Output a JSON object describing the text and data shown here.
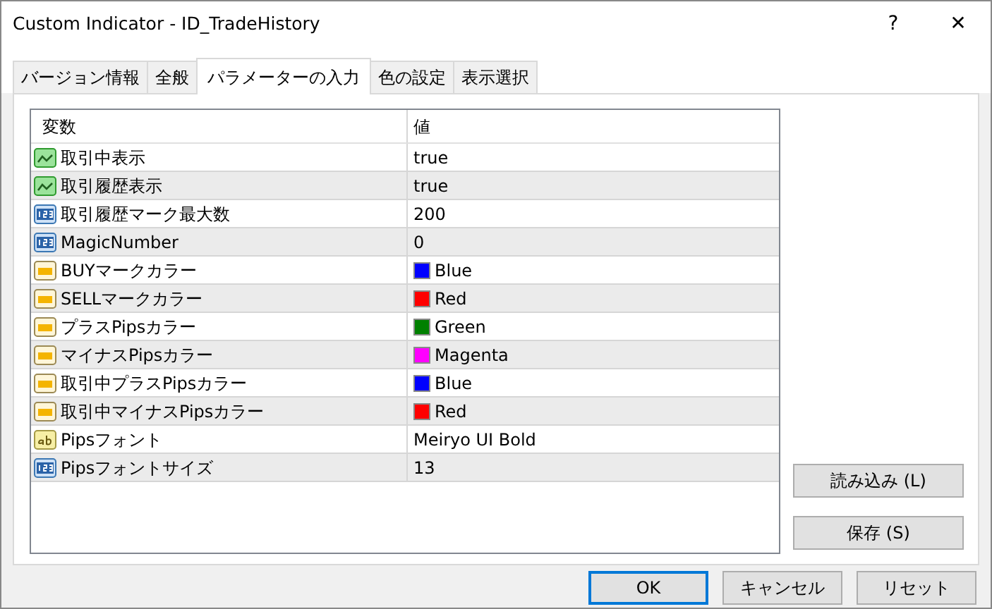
{
  "window": {
    "title": "Custom Indicator - ID_TradeHistory",
    "help": "?",
    "close": "✕"
  },
  "tabs": [
    {
      "label": "バージョン情報",
      "selected": false
    },
    {
      "label": "全般",
      "selected": false
    },
    {
      "label": "パラメーターの入力",
      "selected": true
    },
    {
      "label": "色の設定",
      "selected": false
    },
    {
      "label": "表示選択",
      "selected": false
    }
  ],
  "table": {
    "columns": [
      "変数",
      "値"
    ],
    "rows": [
      {
        "kind": "bool",
        "name": "取引中表示",
        "value": "true"
      },
      {
        "kind": "bool",
        "name": "取引履歴表示",
        "value": "true"
      },
      {
        "kind": "int",
        "name": "取引履歴マーク最大数",
        "value": "200"
      },
      {
        "kind": "int",
        "name": "MagicNumber",
        "value": "0"
      },
      {
        "kind": "color",
        "name": "BUYマークカラー",
        "value": "Blue",
        "color": "#0000ff"
      },
      {
        "kind": "color",
        "name": "SELLマークカラー",
        "value": "Red",
        "color": "#ff0000"
      },
      {
        "kind": "color",
        "name": "プラスPipsカラー",
        "value": "Green",
        "color": "#008000"
      },
      {
        "kind": "color",
        "name": "マイナスPipsカラー",
        "value": "Magenta",
        "color": "#ff00ff"
      },
      {
        "kind": "color",
        "name": "取引中プラスPipsカラー",
        "value": "Blue",
        "color": "#0000ff"
      },
      {
        "kind": "color",
        "name": "取引中マイナスPipsカラー",
        "value": "Red",
        "color": "#ff0000"
      },
      {
        "kind": "string",
        "name": "Pipsフォント",
        "value": "Meiryo UI Bold"
      },
      {
        "kind": "int",
        "name": "Pipsフォントサイズ",
        "value": "13"
      }
    ]
  },
  "side_buttons": [
    "読み込み (L)",
    "保存 (S)"
  ],
  "buttons": [
    {
      "label": "OK",
      "default": true
    },
    {
      "label": "キャンセル",
      "default": false
    },
    {
      "label": "リセット",
      "default": false
    }
  ]
}
